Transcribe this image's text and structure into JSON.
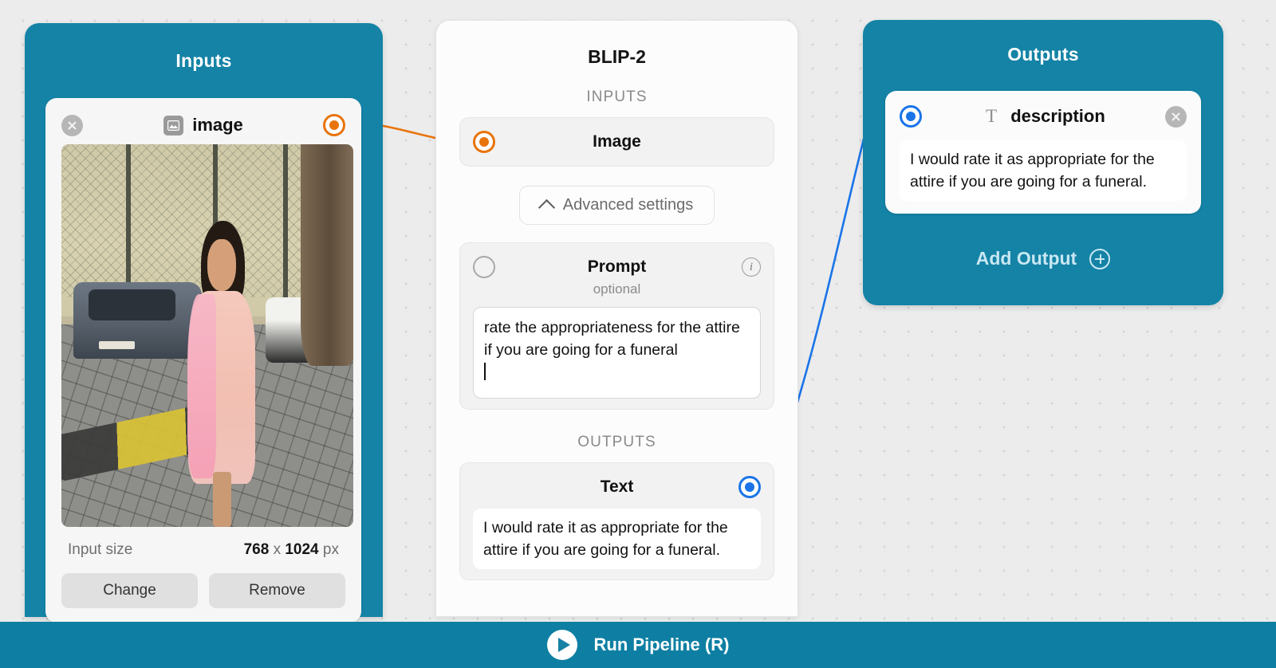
{
  "theme": {
    "teal": "#1483a6",
    "orange": "#e8740c",
    "blue": "#1a74e8",
    "canvas_bg": "#ececec"
  },
  "inputs_panel": {
    "title": "Inputs",
    "card": {
      "name": "image",
      "type_icon": "image-icon",
      "close_icon": "close-icon",
      "port_icon": "output-port-orange",
      "size_label": "Input size",
      "size_width": "768",
      "size_separator": "x",
      "size_height": "1024",
      "size_unit": "px",
      "change_label": "Change",
      "remove_label": "Remove"
    }
  },
  "model_panel": {
    "title": "BLIP-2",
    "inputs_label": "INPUTS",
    "outputs_label": "OUTPUTS",
    "image_slot": {
      "label": "Image",
      "port_icon": "input-port-orange"
    },
    "advanced_settings": {
      "label": "Advanced settings",
      "chevron_icon": "chevron-up-icon"
    },
    "prompt_slot": {
      "label": "Prompt",
      "sublabel": "optional",
      "info_icon": "info-icon",
      "port_icon": "input-port-empty",
      "value": "rate the appropriateness for the attire if you are going for a funeral"
    },
    "text_slot": {
      "label": "Text",
      "port_icon": "output-port-blue",
      "value": "I would rate it as appropriate for the attire if you are going for a funeral."
    }
  },
  "outputs_panel": {
    "title": "Outputs",
    "card": {
      "name": "description",
      "type_icon": "text-icon",
      "close_icon": "close-icon",
      "port_icon": "input-port-blue",
      "value": "I would rate it as appropriate for the attire if you are going for a funeral."
    },
    "add_output_label": "Add Output",
    "add_output_icon": "plus-circle-icon"
  },
  "run_bar": {
    "label": "Run Pipeline (R)",
    "play_icon": "play-icon"
  }
}
